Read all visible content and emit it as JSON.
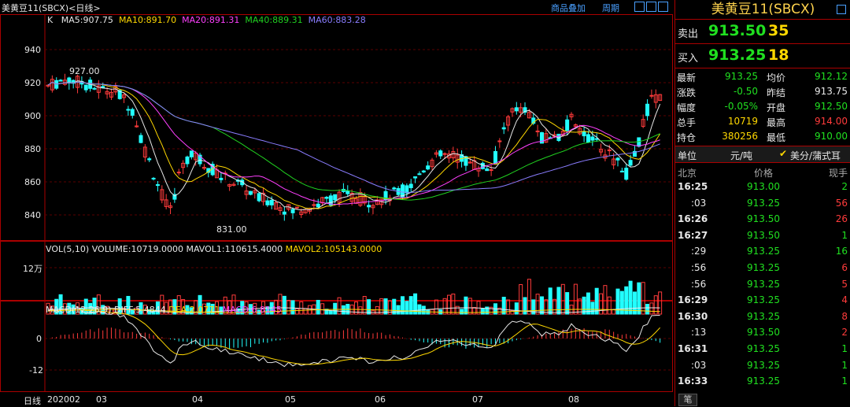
{
  "topbar": {
    "left_title": "美黄豆11(SBCX)<日线>",
    "link_overlay": "商品叠加",
    "link_period": "周期"
  },
  "ma_legend": {
    "prefix": "K",
    "ma5": "MA5:907.75",
    "ma10": "MA10:891.70",
    "ma20": "MA20:891.31",
    "ma40": "MA40:889.31",
    "ma60": "MA60:883.28",
    "colors": {
      "ma5": "#e8e8e8",
      "ma10": "#ffd800",
      "ma20": "#ff40ff",
      "ma40": "#20d020",
      "ma60": "#8a7dff"
    }
  },
  "price_axis": [
    "940",
    "920",
    "900",
    "880",
    "860",
    "840"
  ],
  "annotations": {
    "high": "927.00",
    "low": "831.00"
  },
  "volume_legend": {
    "prefix": "VOL(5,10)",
    "volume": "VOLUME:10719.0000",
    "mavol1": "MAVOL1:110615.4000",
    "mavol2": "MAVOL2:105143.0000"
  },
  "volume_axis": [
    "12万"
  ],
  "macd_legend": {
    "prefix": "MACD(12,26,9)",
    "diff": "DIFF:5.4844",
    "dea": "DEA:2.0771",
    "macd": "MACD:6.8145"
  },
  "macd_axis": [
    "0",
    "-12"
  ],
  "bottom_axis": {
    "corner_label": "日线",
    "ticks": [
      "202002",
      "03",
      "04",
      "05",
      "06",
      "07",
      "08"
    ]
  },
  "panel": {
    "title": "美黄豆11(SBCX)",
    "ask_label": "卖出",
    "ask_price": "913.50",
    "ask_qty": "35",
    "bid_label": "买入",
    "bid_price": "913.25",
    "bid_qty": "18",
    "stats": [
      {
        "l1": "最新",
        "v1": "913.25",
        "l2": "均价",
        "v2": "912.12"
      },
      {
        "l1": "涨跌",
        "v1": "-0.50",
        "l2": "昨结",
        "v2": "913.75"
      },
      {
        "l1": "幅度",
        "v1": "-0.05%",
        "l2": "开盘",
        "v2": "912.50"
      },
      {
        "l1": "总手",
        "v1": "10719",
        "l2": "最高",
        "v2": "914.00"
      },
      {
        "l1": "持仓",
        "v1": "380256",
        "l2": "最低",
        "v2": "910.00"
      }
    ],
    "unit_label": "单位",
    "unit_value": "元/吨",
    "unit_option": "美分/蒲式耳",
    "ticks_header": {
      "loc": "北京",
      "price": "价格",
      "qty": "现手"
    },
    "ticks": [
      {
        "time": "16:25",
        "price": "913.00",
        "qty": "2",
        "dir": "down"
      },
      {
        "time": ":03",
        "price": "913.25",
        "qty": "56",
        "dir": "up"
      },
      {
        "time": "16:26",
        "price": "913.50",
        "qty": "26",
        "dir": "up"
      },
      {
        "time": "16:27",
        "price": "913.50",
        "qty": "1",
        "dir": "down"
      },
      {
        "time": ":29",
        "price": "913.25",
        "qty": "16",
        "dir": "down"
      },
      {
        "time": ":56",
        "price": "913.25",
        "qty": "6",
        "dir": "up"
      },
      {
        "time": ":56",
        "price": "913.25",
        "qty": "5",
        "dir": "up"
      },
      {
        "time": "16:29",
        "price": "913.25",
        "qty": "4",
        "dir": "up"
      },
      {
        "time": "16:30",
        "price": "913.25",
        "qty": "8",
        "dir": "up"
      },
      {
        "time": ":13",
        "price": "913.50",
        "qty": "2",
        "dir": "up"
      },
      {
        "time": "16:31",
        "price": "913.25",
        "qty": "1",
        "dir": "down"
      },
      {
        "time": ":03",
        "price": "913.25",
        "qty": "1",
        "dir": "down"
      },
      {
        "time": "16:33",
        "price": "913.25",
        "qty": "1",
        "dir": "down"
      }
    ],
    "footer_tab": "笔"
  }
}
